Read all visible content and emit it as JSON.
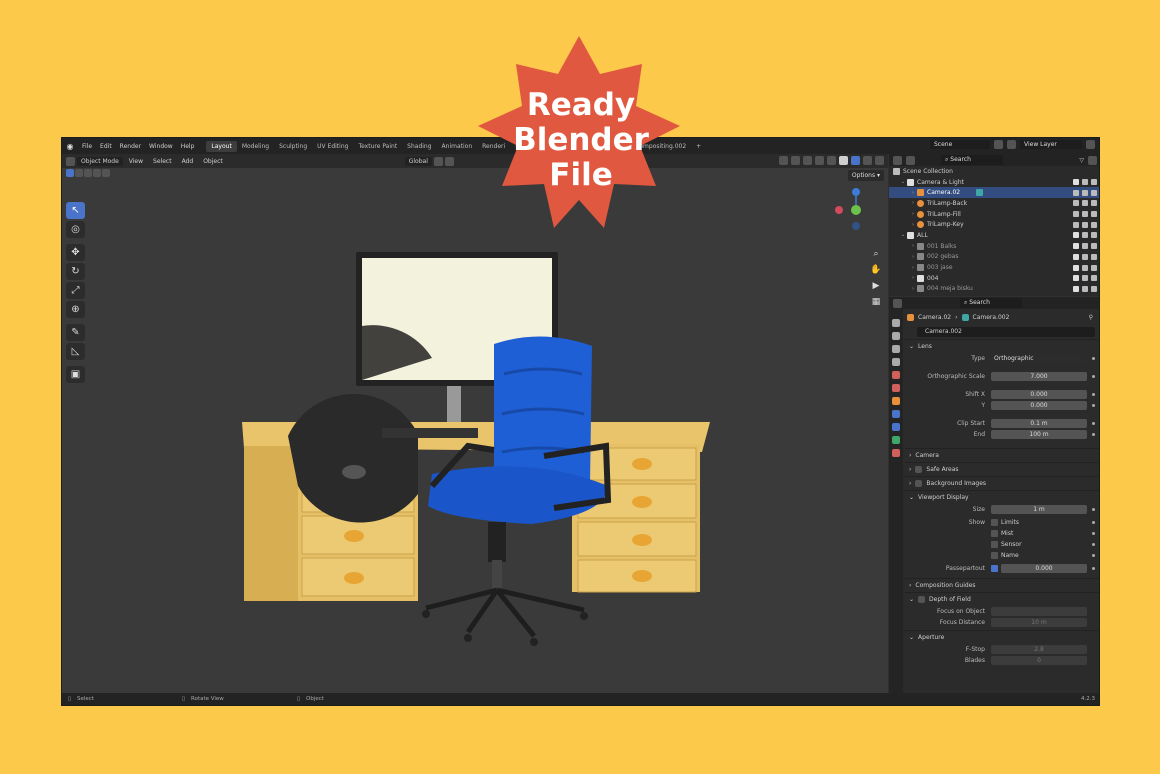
{
  "topbar": {
    "menus": [
      "File",
      "Edit",
      "Render",
      "Window",
      "Help"
    ],
    "workspaces": [
      "Layout",
      "Modeling",
      "Sculpting",
      "UV Editing",
      "Texture Paint",
      "Shading",
      "Animation",
      "Renderi"
    ],
    "extra_tab": "Compositing.002",
    "scene_label": "Scene",
    "view_layer_label": "View Layer"
  },
  "viewport_header": {
    "mode": "Object Mode",
    "menus": [
      "View",
      "Select",
      "Add",
      "Object"
    ],
    "orientation": "Global",
    "options_label": "Options"
  },
  "outliner": {
    "search_placeholder": "Search",
    "rows": [
      {
        "label": "Scene Collection",
        "level": 0
      },
      {
        "label": "Camera & Light",
        "level": 1
      },
      {
        "label": "Camera.02",
        "level": 2,
        "selected": true
      },
      {
        "label": "TriLamp-Back",
        "level": 2
      },
      {
        "label": "TriLamp-Fill",
        "level": 2
      },
      {
        "label": "TriLamp-Key",
        "level": 2
      },
      {
        "label": "ALL",
        "level": 1
      },
      {
        "label": "001 Balks",
        "level": 2
      },
      {
        "label": "002 gebas",
        "level": 2
      },
      {
        "label": "003 jase",
        "level": 2
      },
      {
        "label": "004",
        "level": 2
      },
      {
        "label": "004 meja bisku",
        "level": 2
      }
    ]
  },
  "properties": {
    "search_placeholder": "Search",
    "breadcrumb_object": "Camera.02",
    "breadcrumb_data": "Camera.002",
    "data_name": "Camera.002",
    "lens_section": "Lens",
    "type_label": "Type",
    "type_value": "Orthographic",
    "ortho_scale_label": "Orthographic Scale",
    "ortho_scale_value": "7.000",
    "shift_x_label": "Shift X",
    "shift_x_value": "0.000",
    "shift_y_label": "Y",
    "shift_y_value": "0.000",
    "clip_start_label": "Clip Start",
    "clip_start_value": "0.1 m",
    "clip_end_label": "End",
    "clip_end_value": "100 m",
    "camera_section": "Camera",
    "safe_areas_section": "Safe Areas",
    "background_images_section": "Background Images",
    "viewport_display_section": "Viewport Display",
    "size_label": "Size",
    "size_value": "1 m",
    "show_label": "Show",
    "show_options": [
      "Limits",
      "Mist",
      "Sensor",
      "Name"
    ],
    "passepartout_label": "Passepartout",
    "passepartout_value": "0.000",
    "composition_guides_section": "Composition Guides",
    "depth_of_field_section": "Depth of Field",
    "focus_object_label": "Focus on Object",
    "focus_distance_label": "Focus Distance",
    "focus_distance_value": "10 m",
    "aperture_section": "Aperture",
    "fstop_label": "F-Stop",
    "fstop_value": "2.8",
    "blades_label": "Blades",
    "blades_value": "0"
  },
  "statusbar": {
    "select": "Select",
    "rotate": "Rotate View",
    "object": "Object",
    "version": "4.2.3"
  },
  "badge": {
    "lines": [
      "Ready",
      "Blender",
      "File"
    ],
    "color": "#e0583f"
  },
  "colors": {
    "background": "#fcc94a",
    "accent": "#4a74c9",
    "chair": "#1f5fd6",
    "desk": "#e6c066",
    "knobs": "#e8a533"
  }
}
